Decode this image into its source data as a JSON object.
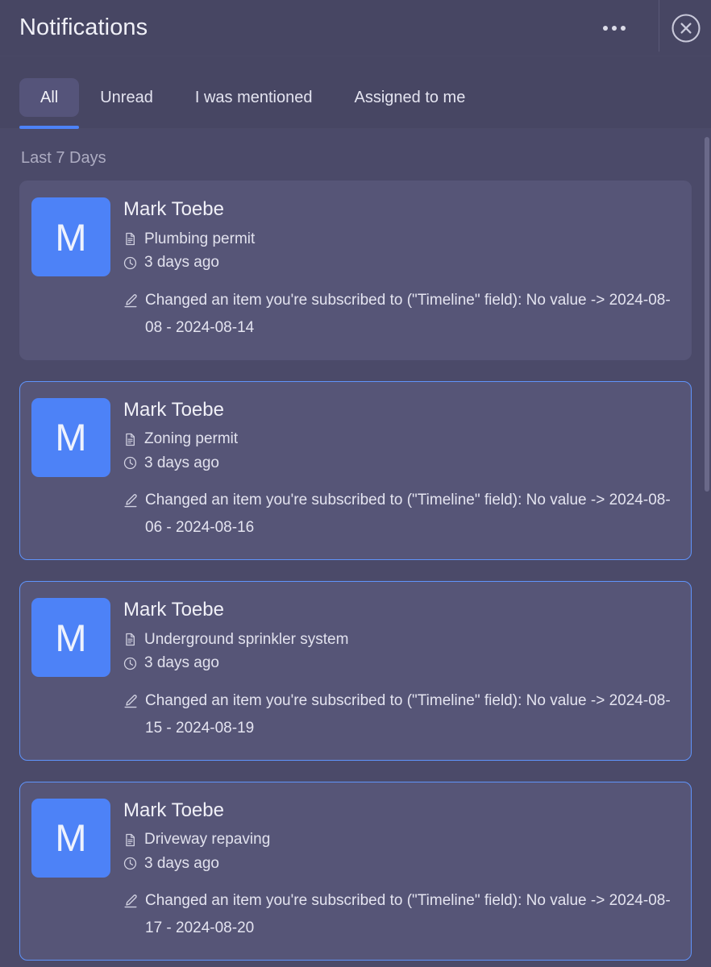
{
  "header": {
    "title": "Notifications",
    "kebab_icon": "more-horizontal-icon",
    "close_icon": "close-circle-icon"
  },
  "tabs": [
    {
      "label": "All",
      "active": true
    },
    {
      "label": "Unread",
      "active": false
    },
    {
      "label": "I was mentioned",
      "active": false
    },
    {
      "label": "Assigned to me",
      "active": false
    }
  ],
  "sections": [
    {
      "label": "Last 7 Days",
      "notifications": [
        {
          "avatar_initial": "M",
          "name": "Mark Toebe",
          "item_icon": "document-icon",
          "item": "Plumbing permit",
          "time_icon": "clock-icon",
          "time": "3 days ago",
          "desc_icon": "pencil-edit-icon",
          "description": "Changed an item you're subscribed to (\"Timeline\" field): No value -> 2024-08-08 - 2024-08-14",
          "unread": false
        },
        {
          "avatar_initial": "M",
          "name": "Mark Toebe",
          "item_icon": "document-icon",
          "item": "Zoning permit",
          "time_icon": "clock-icon",
          "time": "3 days ago",
          "desc_icon": "pencil-edit-icon",
          "description": "Changed an item you're subscribed to (\"Timeline\" field): No value -> 2024-08-06 - 2024-08-16",
          "unread": true
        },
        {
          "avatar_initial": "M",
          "name": "Mark Toebe",
          "item_icon": "document-icon",
          "item": "Underground sprinkler system",
          "time_icon": "clock-icon",
          "time": "3 days ago",
          "desc_icon": "pencil-edit-icon",
          "description": "Changed an item you're subscribed to (\"Timeline\" field): No value -> 2024-08-15 - 2024-08-19",
          "unread": true
        },
        {
          "avatar_initial": "M",
          "name": "Mark Toebe",
          "item_icon": "document-icon",
          "item": "Driveway repaving",
          "time_icon": "clock-icon",
          "time": "3 days ago",
          "desc_icon": "pencil-edit-icon",
          "description": "Changed an item you're subscribed to (\"Timeline\" field): No value -> 2024-08-17 - 2024-08-20",
          "unread": true
        }
      ]
    }
  ],
  "colors": {
    "panel_background": "#4b4a69",
    "header_background": "#474663",
    "card_background": "#565577",
    "accent_blue": "#4d82f7",
    "unread_border": "#5f94fb",
    "avatar_blue": "#4d82f7",
    "muted_text": "#adacc2",
    "primary_text": "#f0f0f7"
  }
}
